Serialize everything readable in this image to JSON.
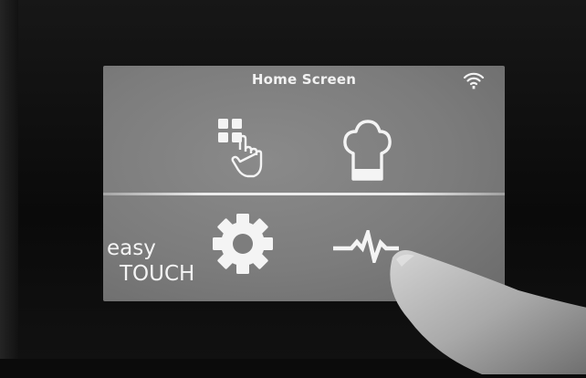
{
  "screen": {
    "title": "Home Screen"
  },
  "brand": {
    "line1": "easy",
    "line2": "TOUCH"
  },
  "icons": {
    "status": "wifi-icon",
    "tiles": [
      "apps-touch-icon",
      "chef-hat-icon",
      "gear-icon",
      "activity-pulse-icon"
    ]
  },
  "colors": {
    "screen_bg": "#7f7f7f",
    "icon": "#f4f4f4",
    "bezel": "#0b0b0b"
  }
}
